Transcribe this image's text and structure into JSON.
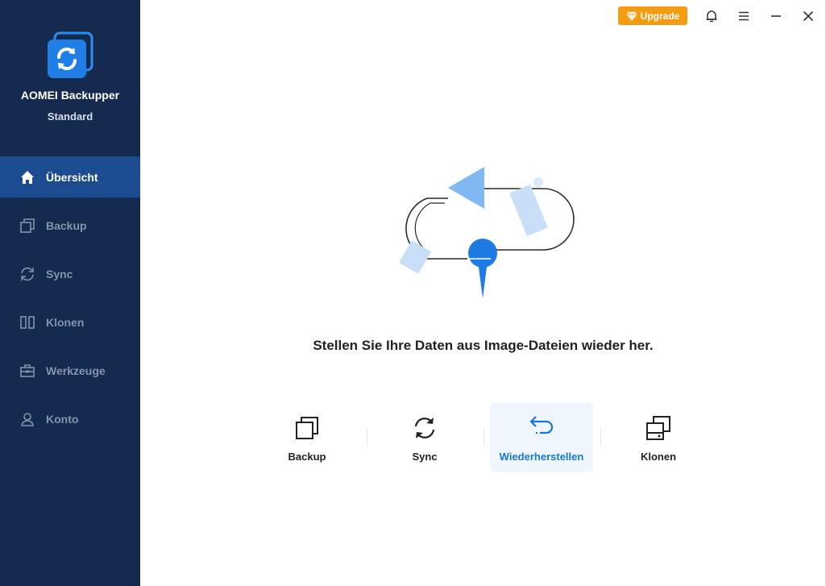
{
  "app": {
    "name": "AOMEI Backupper",
    "edition": "Standard"
  },
  "sidebar": {
    "items": [
      {
        "label": "Übersicht",
        "icon": "home-icon",
        "active": true
      },
      {
        "label": "Backup",
        "icon": "backup-icon",
        "active": false
      },
      {
        "label": "Sync",
        "icon": "sync-icon",
        "active": false
      },
      {
        "label": "Klonen",
        "icon": "clone-icon",
        "active": false
      },
      {
        "label": "Werkzeuge",
        "icon": "toolbox-icon",
        "active": false
      },
      {
        "label": "Konto",
        "icon": "user-icon",
        "active": false
      }
    ]
  },
  "topbar": {
    "upgrade_label": "Upgrade"
  },
  "main": {
    "headline": "Stellen Sie Ihre Daten aus Image-Dateien wieder her.",
    "actions": [
      {
        "label": "Backup",
        "icon": "backup-icon",
        "selected": false
      },
      {
        "label": "Sync",
        "icon": "sync-icon",
        "selected": false
      },
      {
        "label": "Wiederherstellen",
        "icon": "restore-icon",
        "selected": true
      },
      {
        "label": "Klonen",
        "icon": "clone-icon",
        "selected": false
      }
    ]
  },
  "colors": {
    "sidebar_bg": "#152a4f",
    "sidebar_active": "#1c4c8f",
    "accent": "#1677d6",
    "upgrade": "#f39c12"
  }
}
